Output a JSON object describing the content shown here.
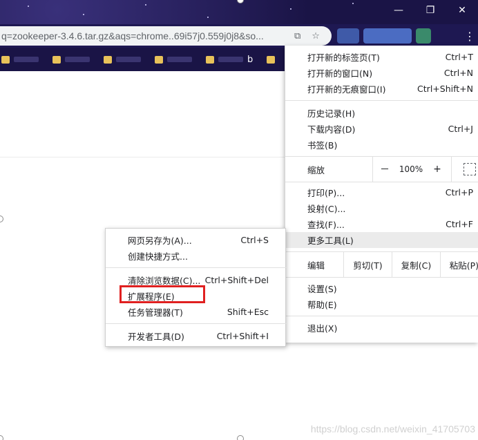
{
  "browser": {
    "url": "q=zookeeper-3.4.6.tar.gz&aqs=chrome..69i57j0.559j0j8&so...",
    "bookmark_visible_text": "b"
  },
  "menu": {
    "new_tab": {
      "label": "打开新的标签页(T)",
      "shortcut": "Ctrl+T"
    },
    "new_window": {
      "label": "打开新的窗口(N)",
      "shortcut": "Ctrl+N"
    },
    "incognito": {
      "label": "打开新的无痕窗口(I)",
      "shortcut": "Ctrl+Shift+N"
    },
    "history": {
      "label": "历史记录(H)"
    },
    "downloads": {
      "label": "下载内容(D)",
      "shortcut": "Ctrl+J"
    },
    "bookmarks": {
      "label": "书签(B)"
    },
    "zoom": {
      "label": "缩放",
      "minus": "－",
      "value": "100%",
      "plus": "+"
    },
    "print": {
      "label": "打印(P)...",
      "shortcut": "Ctrl+P"
    },
    "cast": {
      "label": "投射(C)..."
    },
    "find": {
      "label": "查找(F)...",
      "shortcut": "Ctrl+F"
    },
    "more_tools": {
      "label": "更多工具(L)"
    },
    "edit": {
      "label": "编辑",
      "cut": "剪切(T)",
      "copy": "复制(C)",
      "paste": "粘贴(P)"
    },
    "settings": {
      "label": "设置(S)"
    },
    "help": {
      "label": "帮助(E)"
    },
    "exit": {
      "label": "退出(X)"
    }
  },
  "submenu": {
    "save_page": {
      "label": "网页另存为(A)...",
      "shortcut": "Ctrl+S"
    },
    "create_shortcut": {
      "label": "创建快捷方式..."
    },
    "clear_data": {
      "label": "清除浏览数据(C)...",
      "shortcut": "Ctrl+Shift+Del"
    },
    "extensions": {
      "label": "扩展程序(E)"
    },
    "task_manager": {
      "label": "任务管理器(T)",
      "shortcut": "Shift+Esc"
    },
    "dev_tools": {
      "label": "开发者工具(D)",
      "shortcut": "Ctrl+Shift+I"
    }
  },
  "watermark": "https://blog.csdn.net/weixin_41705703",
  "colors": {
    "highlight": "#e02020",
    "titlebar": "#1a1446"
  }
}
